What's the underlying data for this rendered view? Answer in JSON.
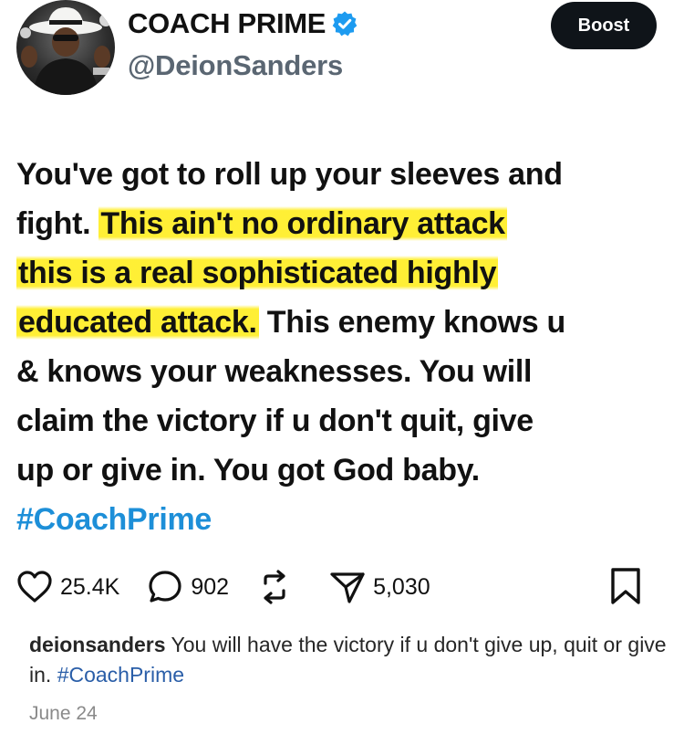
{
  "profile": {
    "display_name": "COACH PRIME",
    "handle": "@DeionSanders",
    "boost_label": "Boost"
  },
  "tweet": {
    "lines": [
      {
        "pre": "You've got to roll up your sleeves and",
        "hl": "",
        "post": ""
      },
      {
        "pre": "fight. ",
        "hl": "This ain't no ordinary attack",
        "post": ""
      },
      {
        "pre": "",
        "hl": "this is a real sophisticated highly",
        "post": ""
      },
      {
        "pre": "",
        "hl": "educated attack.",
        "post": " This enemy knows u"
      },
      {
        "pre": "& knows your weaknesses. You will",
        "hl": "",
        "post": ""
      },
      {
        "pre": "claim the victory if u don't quit, give",
        "hl": "",
        "post": ""
      },
      {
        "pre": "up or give in. You got God baby.",
        "hl": "",
        "post": ""
      }
    ],
    "hashtag": "#CoachPrime"
  },
  "actions": {
    "likes": "25.4K",
    "comments": "902",
    "shares": "5,030"
  },
  "caption": {
    "username": "deionsanders",
    "text": " You will have the victory if u don't give up, quit or give in. ",
    "hashtag": "#CoachPrime"
  },
  "date": "June 24",
  "colors": {
    "highlight": "#ffec12",
    "hashtag": "#1d8fd8",
    "verified": "#1d9bf0",
    "boost_bg": "#0f1419"
  }
}
